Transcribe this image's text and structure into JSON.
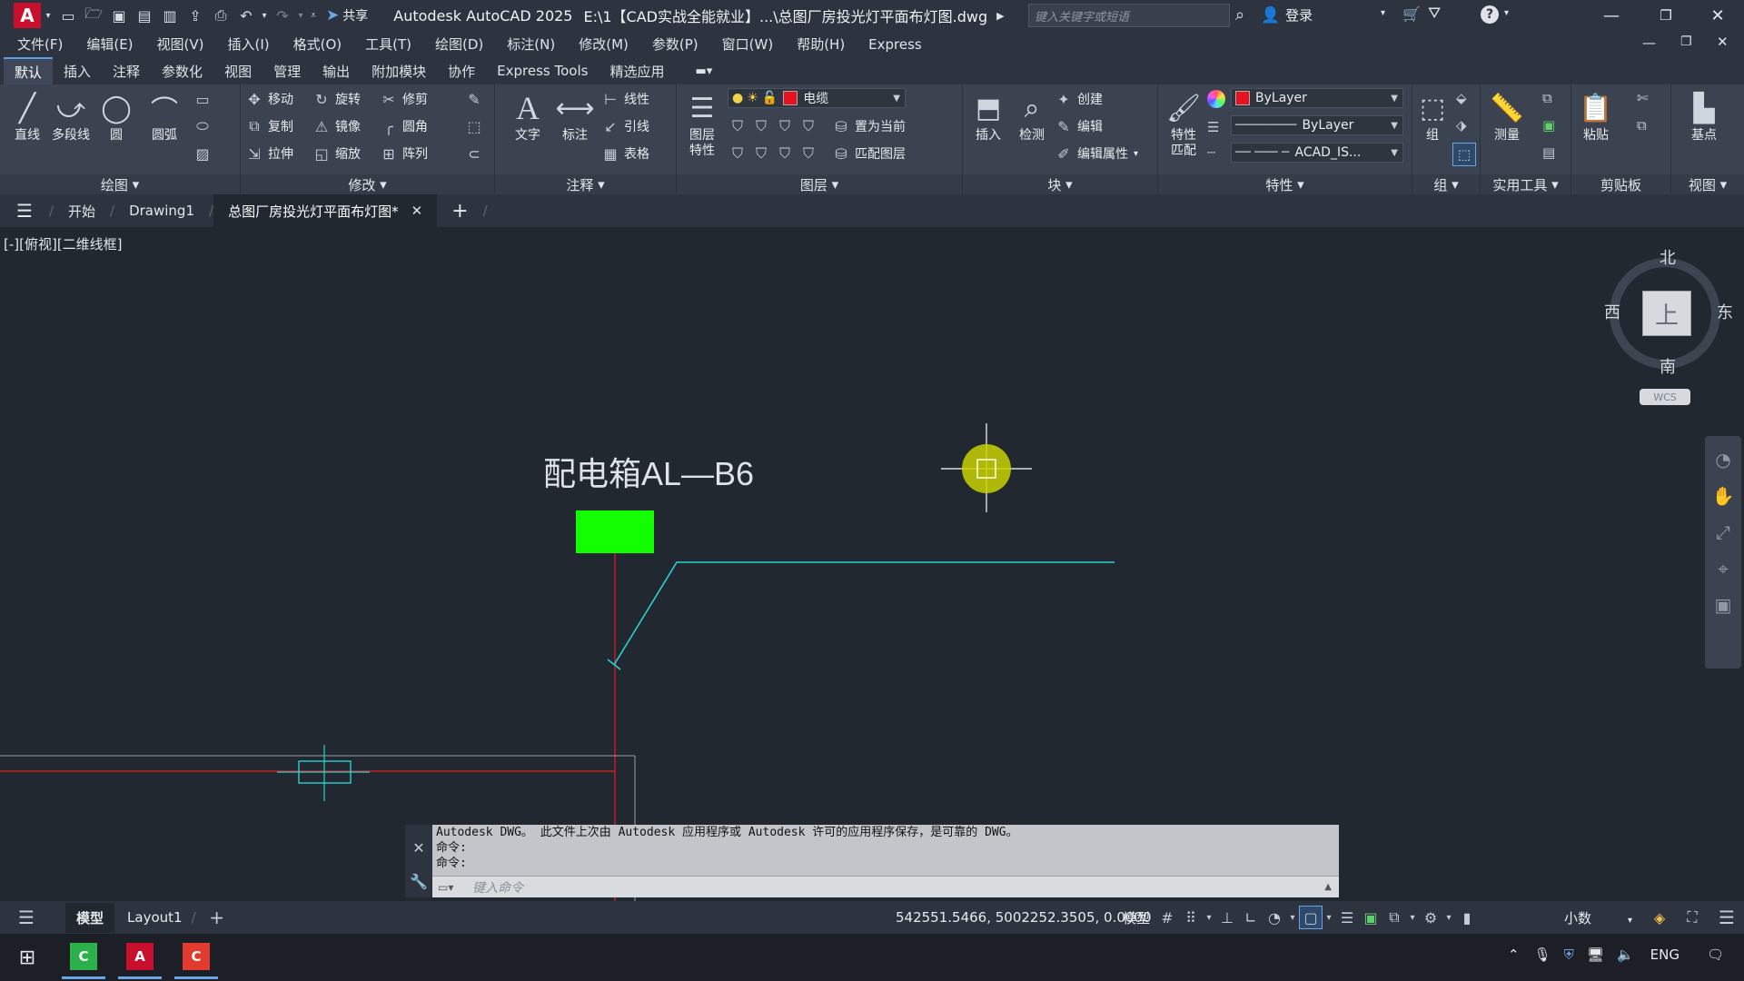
{
  "window": {
    "app_title": "Autodesk AutoCAD 2025",
    "file_path": "E:\\1【CAD实战全能就业】...\\总图厂房投光灯平面布灯图.dwg",
    "share": "共享",
    "search_placeholder": "键入关键字或短语",
    "login": "登录"
  },
  "menu": [
    "文件(F)",
    "编辑(E)",
    "视图(V)",
    "插入(I)",
    "格式(O)",
    "工具(T)",
    "绘图(D)",
    "标注(N)",
    "修改(M)",
    "参数(P)",
    "窗口(W)",
    "帮助(H)",
    "Express"
  ],
  "ribbon_tabs": [
    "默认",
    "插入",
    "注释",
    "参数化",
    "视图",
    "管理",
    "输出",
    "附加模块",
    "协作",
    "Express Tools",
    "精选应用"
  ],
  "ribbon": {
    "draw": {
      "title": "绘图",
      "line": "直线",
      "polyline": "多段线",
      "circle": "圆",
      "arc": "圆弧"
    },
    "modify": {
      "title": "修改",
      "move": "移动",
      "rotate": "旋转",
      "trim": "修剪",
      "copy": "复制",
      "mirror": "镜像",
      "fillet": "圆角",
      "stretch": "拉伸",
      "scale": "缩放",
      "array": "阵列"
    },
    "annotation": {
      "title": "注释",
      "text": "文字",
      "dimension": "标注",
      "linear": "线性",
      "leader": "引线",
      "table": "表格"
    },
    "layers": {
      "title": "图层",
      "props": "图层\n特性",
      "current_layer": "电缆",
      "set_current": "置为当前",
      "match": "匹配图层"
    },
    "block": {
      "title": "块",
      "insert": "插入",
      "detect": "检测",
      "create": "创建",
      "edit": "编辑",
      "edit_attr": "编辑属性"
    },
    "properties": {
      "title": "特性",
      "match": "特性\n匹配",
      "color": "ByLayer",
      "linetype": "ByLayer",
      "lineweight": "ACAD_IS..."
    },
    "groups": {
      "title": "组",
      "group": "组"
    },
    "utilities": {
      "title": "实用工具",
      "measure": "测量"
    },
    "clipboard": {
      "title": "剪贴板",
      "paste": "粘贴"
    },
    "view": {
      "title": "视图",
      "base": "基点"
    }
  },
  "file_tabs": {
    "start": "开始",
    "drawing1": "Drawing1",
    "active": "总图厂房投光灯平面布灯图*"
  },
  "viewport_label": "[-][俯视][二维线框]",
  "drawing": {
    "panel_label": "配电箱AL—B6"
  },
  "viewcube": {
    "north": "北",
    "south": "南",
    "east": "东",
    "west": "西",
    "top": "上",
    "wcs": "WCS"
  },
  "command": {
    "history": [
      "Autodesk DWG。  此文件上次由 Autodesk 应用程序或 Autodesk 许可的应用程序保存，是可靠的 DWG。",
      "命令:",
      "命令:"
    ],
    "placeholder": "键入命令"
  },
  "status": {
    "model_tab": "模型",
    "layout_tab": "Layout1",
    "coords": "542551.5466, 5002252.3505, 0.0000",
    "model_btn": "模型",
    "units": "小数"
  },
  "taskbar": {
    "lang": "ENG"
  },
  "colors": {
    "accent": "#5e9ce0",
    "panel_box": "#11ff00",
    "cyan_line": "#2ad1d1",
    "red_line": "#e02020",
    "cursor": "#c9d100"
  }
}
